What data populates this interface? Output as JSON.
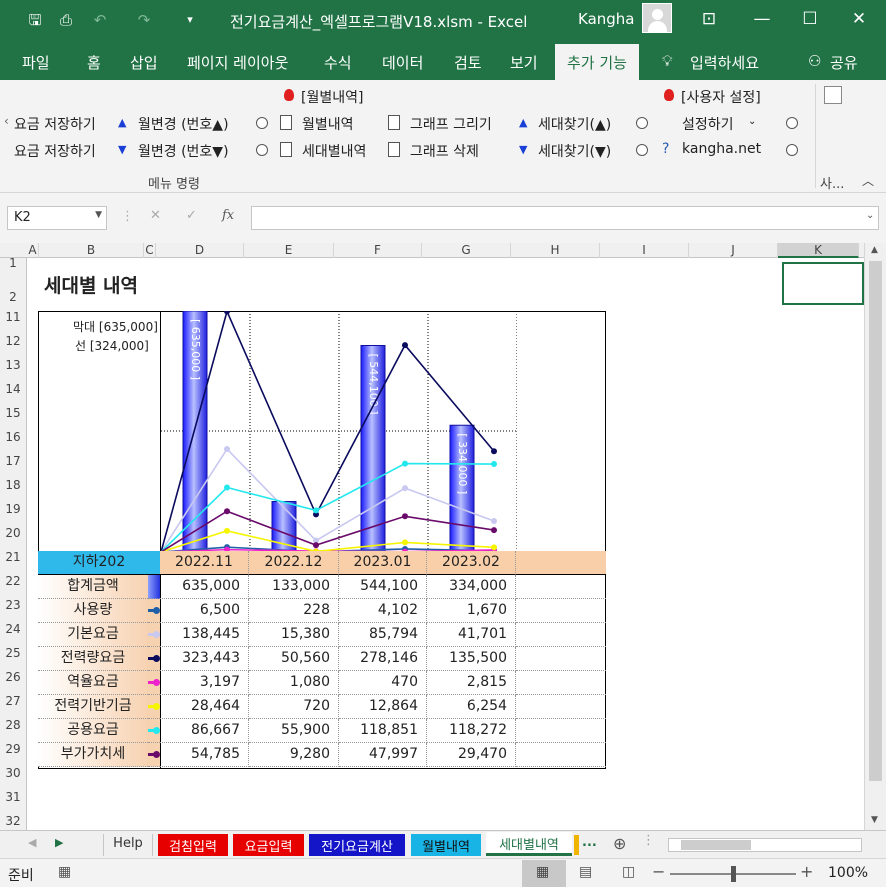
{
  "window": {
    "title": "전기요금계산_엑셀프로그램V18.xlsm  -  Excel",
    "user": "Kangha"
  },
  "tabs": [
    "파일",
    "홈",
    "삽입",
    "페이지 레이아웃",
    "수식",
    "데이터",
    "검토",
    "보기",
    "추가 기능",
    "입력하세요",
    "공유"
  ],
  "ribbon": {
    "save1": "요금 저장하기",
    "save2": "요금 저장하기",
    "month_up": "월변경 (번호▲)",
    "month_down": "월변경 (번호▼)",
    "monthly_header": "[월별내역]",
    "monthly": "월별내역",
    "household": "세대별내역",
    "graph_draw": "그래프 그리기",
    "graph_delete": "그래프 삭제",
    "find_up": "세대찾기(▲)",
    "find_down": "세대찾기(▼)",
    "user_settings_header": "[사용자 설정]",
    "settings": "설정하기",
    "site": "kangha.net",
    "group_label": "메뉴 명령",
    "group_label2": "사..."
  },
  "namebox": "K2",
  "columns": [
    "A",
    "B",
    "C",
    "D",
    "E",
    "F",
    "G",
    "H",
    "I",
    "J",
    "K"
  ],
  "rows": [
    "1",
    "2",
    "11",
    "12",
    "13",
    "14",
    "15",
    "16",
    "17",
    "18",
    "19",
    "20",
    "21",
    "22",
    "23",
    "24",
    "25",
    "26",
    "27",
    "28",
    "29",
    "30",
    "31",
    "32"
  ],
  "sheet": {
    "title": "세대별 내역",
    "legend_bar": "막대 [635,000]",
    "legend_line": "선 [324,000]",
    "household": "지하202",
    "months": [
      "2022.11",
      "2022.12",
      "2023.01",
      "2023.02"
    ],
    "rows": [
      {
        "label": "합계금액",
        "values": [
          "635,000",
          "133,000",
          "544,100",
          "334,000"
        ],
        "color": "#2233dd"
      },
      {
        "label": "사용량",
        "values": [
          "6,500",
          "228",
          "4,102",
          "1,670"
        ],
        "color": "#1f5fa8"
      },
      {
        "label": "기본요금",
        "values": [
          "138,445",
          "15,380",
          "85,794",
          "41,701"
        ],
        "color": "#c8c8f0"
      },
      {
        "label": "전력량요금",
        "values": [
          "323,443",
          "50,560",
          "278,146",
          "135,500"
        ],
        "color": "#0b0b5e"
      },
      {
        "label": "역율요금",
        "values": [
          "3,197",
          "1,080",
          "470",
          "2,815"
        ],
        "color": "#ee22cc"
      },
      {
        "label": "전력기반기금",
        "values": [
          "28,464",
          "720",
          "12,864",
          "6,254"
        ],
        "color": "#f5f500"
      },
      {
        "label": "공용요금",
        "values": [
          "86,667",
          "55,900",
          "118,851",
          "118,272"
        ],
        "color": "#22e8ee"
      },
      {
        "label": "부가가치세",
        "values": [
          "54,785",
          "9,280",
          "47,997",
          "29,470"
        ],
        "color": "#6a0a6a"
      }
    ],
    "bar_labels": [
      "[ 635,000 ]",
      "[ 544,100 ]",
      "[ 334,000 ]"
    ]
  },
  "chart_data": {
    "type": "bar",
    "categories": [
      "2022.11",
      "2022.12",
      "2023.01",
      "2023.02"
    ],
    "series": [
      {
        "name": "합계금액",
        "type": "bar",
        "values": [
          635000,
          133000,
          544100,
          334000
        ]
      },
      {
        "name": "사용량",
        "type": "line",
        "values": [
          6500,
          228,
          4102,
          1670
        ]
      },
      {
        "name": "기본요금",
        "type": "line",
        "values": [
          138445,
          15380,
          85794,
          41701
        ]
      },
      {
        "name": "전력량요금",
        "type": "line",
        "values": [
          323443,
          50560,
          278146,
          135500
        ]
      },
      {
        "name": "역율요금",
        "type": "line",
        "values": [
          3197,
          1080,
          470,
          2815
        ]
      },
      {
        "name": "전력기반기금",
        "type": "line",
        "values": [
          28464,
          720,
          12864,
          6254
        ]
      },
      {
        "name": "공용요금",
        "type": "line",
        "values": [
          86667,
          55900,
          118851,
          118272
        ]
      },
      {
        "name": "부가가치세",
        "type": "line",
        "values": [
          54785,
          9280,
          47997,
          29470
        ]
      }
    ],
    "bar_max": 635000,
    "line_max": 324000
  },
  "sheet_tabs": [
    {
      "label": "Help",
      "color": "#f0f0f0",
      "text": "#333"
    },
    {
      "label": "검침입력",
      "color": "#e60000",
      "text": "#fff"
    },
    {
      "label": "요금입력",
      "color": "#e60000",
      "text": "#fff"
    },
    {
      "label": "전기요금계산",
      "color": "#1414c8",
      "text": "#fff"
    },
    {
      "label": "월별내역",
      "color": "#19b4e6",
      "text": "#111"
    },
    {
      "label": "세대별내역",
      "color": "#ffffff",
      "text": "#217346"
    }
  ],
  "status": {
    "ready": "준비",
    "zoom": "100%"
  }
}
